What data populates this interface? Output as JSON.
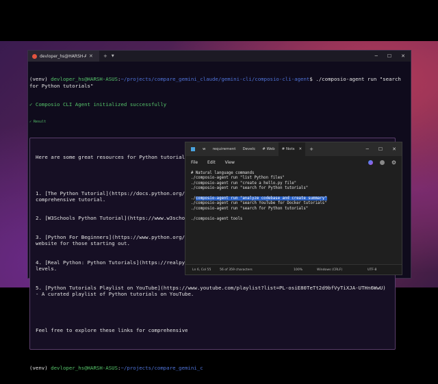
{
  "terminal": {
    "tab_title": "devloper_hs@HARSH-ASUS: ~",
    "lines": {
      "prompt1_venv": "(venv) ",
      "prompt1_user": "devloper_hs@HARSH-ASUS",
      "prompt1_sep": ":",
      "prompt1_path": "~/projects/compare_gemini_claude/gemini-cli/composio-cli-agent",
      "prompt1_cmd": "$ ./composio-agent run \"search for Python tutorials\"",
      "status_ok": "✓ Composio CLI Agent initialized successfully",
      "status_result": "✓ Result",
      "resp_intro": "Here are some great resources for Python tutorials:",
      "resp_1": "1. [The Python Tutorial](https://docs.python.org/3/tutorial/index.html) - Official Python documentation with a comprehensive tutorial.",
      "resp_2": "2. [W3Schools Python Tutorial](https://www.w3schools.com/python/) - User-friendly tutorials for beginners.",
      "resp_3": "3. [Python For Beginners](https://www.python.org/about/gettingstarted/) - A guide provided by the official Python website for those starting out.",
      "resp_4": "4. [Real Python: Python Tutorials](https://realpython.com/) - Offers a variety of tutorials for different skill levels.",
      "resp_5": "5. [Python Tutorials Playlist on YouTube](https://www.youtube.com/playlist?list=PL-osiE80TeTt2d9bfVyTiXJA-UTHn6WwU) - A curated playlist of Python tutorials on YouTube.",
      "resp_outro": "Feel free to explore these links for comprehensive",
      "prompt2_venv": "(venv) ",
      "prompt2_user": "devloper_hs@HARSH-ASUS",
      "prompt2_sep": ":",
      "prompt2_path": "~/projects/compare_gemini_c"
    }
  },
  "notepad": {
    "tabs": [
      "w",
      "requirement",
      "Develc",
      "# Web",
      "# Nots"
    ],
    "menu": {
      "file": "File",
      "edit": "Edit",
      "view": "View"
    },
    "editor_lines": [
      "# Natural language commands",
      "./composio-agent run \"list Python files\"",
      "./composio-agent run \"create a hello.py file\"",
      "./composio-agent run \"search for Python tutorials\"",
      "",
      "./",
      "composio-agent run \"analyze codebase and create summary\"",
      "./composio-agent run \"search YouTube for Docker tutorials\"",
      "./composio-agent run \"search for Python tutorials\"",
      "",
      "./composio-agent tools"
    ],
    "status": {
      "position": "Ln 6, Col 55",
      "chars": "56 of 359 characters",
      "zoom": "100%",
      "line_ending": "Windows (CRLF)",
      "encoding": "UTF-8"
    }
  }
}
